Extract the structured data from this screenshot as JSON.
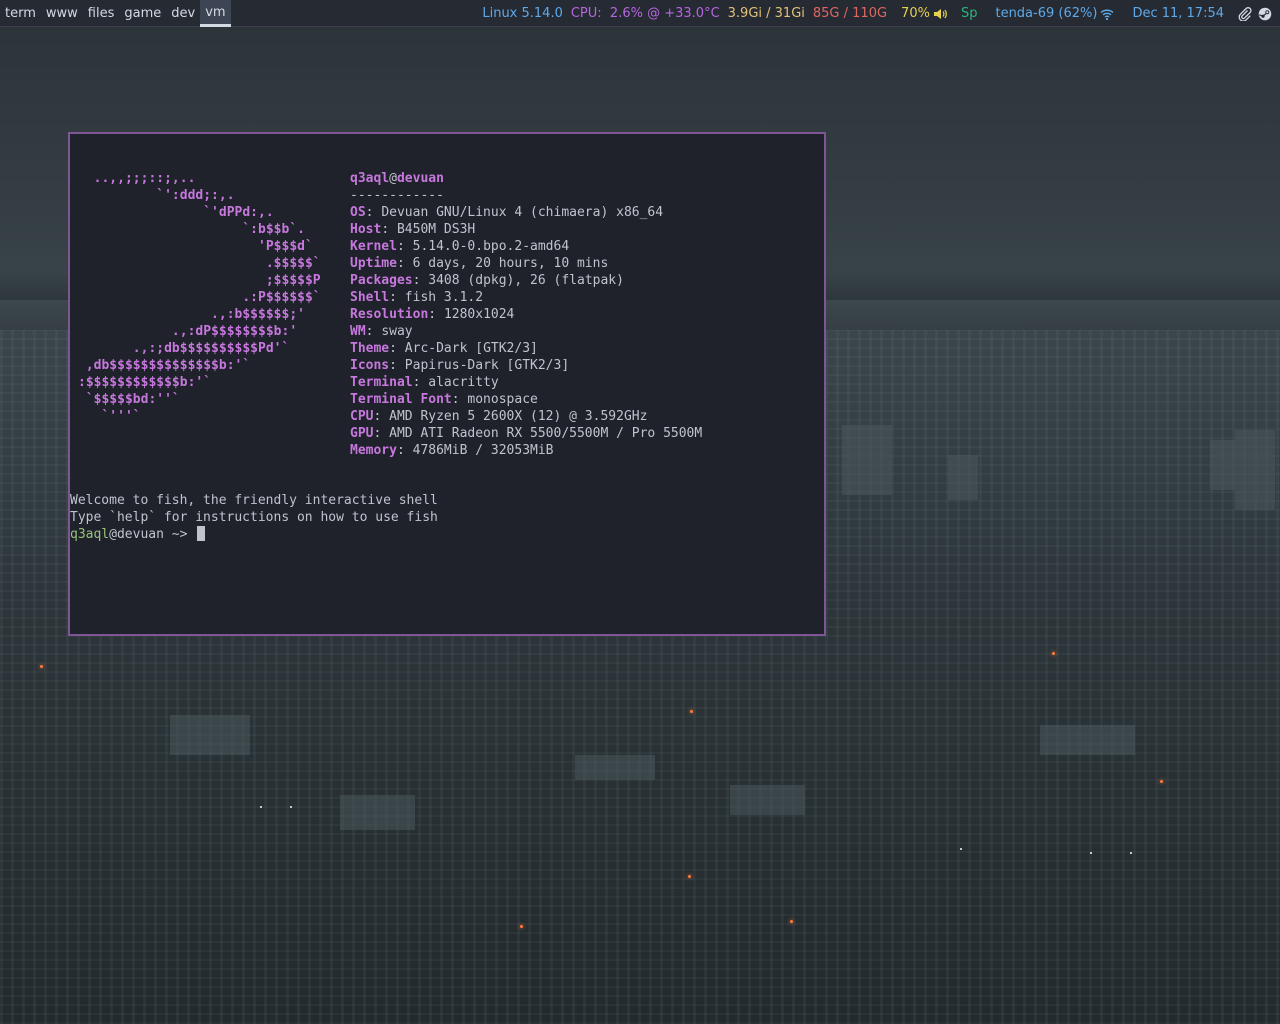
{
  "workspaces": [
    {
      "label": "term",
      "active": false
    },
    {
      "label": "www",
      "active": false
    },
    {
      "label": "files",
      "active": false
    },
    {
      "label": "game",
      "active": false
    },
    {
      "label": "dev",
      "active": false
    },
    {
      "label": "vm",
      "active": true
    }
  ],
  "status": {
    "kernel": {
      "text": "Linux 5.14.0",
      "color": "#5da9e9"
    },
    "cpu": {
      "text": "CPU:  2.6% @ +33.0°C",
      "color": "#b765e0"
    },
    "mem": {
      "text": "3.9Gi / 31Gi",
      "color": "#e2c275"
    },
    "disk": {
      "text": "85G / 110G",
      "color": "#e0675f"
    },
    "volume": {
      "text": "70%",
      "color": "#e6d04f",
      "icon": "volume-icon"
    },
    "sp": {
      "text": "Sp",
      "color": "#2fb37d"
    },
    "wifi": {
      "text": "tenda-69 (62%)",
      "color": "#5da9e9",
      "icon": "wifi-icon"
    },
    "clock": {
      "text": "Dec 11, 17:54",
      "color": "#5da9e9"
    },
    "tray_icons": [
      "paperclip-icon",
      "steam-icon"
    ]
  },
  "terminal": {
    "ascii_art": "  ..,,;;;::;,..\n          `':ddd;:,.\n                `'dPPd:,.\n                     `:b$$b`.\n                       'P$$$d`\n                        .$$$$$`\n                        ;$$$$$P\n                     .:P$$$$$$`\n                 .,:b$$$$$$;'\n            .,:dP$$$$$$$$b:'\n       .,:;db$$$$$$$$$$Pd'`\n ,db$$$$$$$$$$$$$$b:'`\n:$$$$$$$$$$$$b:'`\n `$$$$$bd:''`\n   `'''`",
    "user": "q3aql",
    "at": "@",
    "host": "devuan",
    "separator": "------------",
    "info": [
      {
        "key": "OS",
        "value": "Devuan GNU/Linux 4 (chimaera) x86_64"
      },
      {
        "key": "Host",
        "value": "B450M DS3H"
      },
      {
        "key": "Kernel",
        "value": "5.14.0-0.bpo.2-amd64"
      },
      {
        "key": "Uptime",
        "value": "6 days, 20 hours, 10 mins"
      },
      {
        "key": "Packages",
        "value": "3408 (dpkg), 26 (flatpak)"
      },
      {
        "key": "Shell",
        "value": "fish 3.1.2"
      },
      {
        "key": "Resolution",
        "value": "1280x1024"
      },
      {
        "key": "WM",
        "value": "sway"
      },
      {
        "key": "Theme",
        "value": "Arc-Dark [GTK2/3]"
      },
      {
        "key": "Icons",
        "value": "Papirus-Dark [GTK2/3]"
      },
      {
        "key": "Terminal",
        "value": "alacritty"
      },
      {
        "key": "Terminal Font",
        "value": "monospace"
      },
      {
        "key": "CPU",
        "value": "AMD Ryzen 5 2600X (12) @ 3.592GHz"
      },
      {
        "key": "GPU",
        "value": "AMD ATI Radeon RX 5500/5500M / Pro 5500M"
      },
      {
        "key": "Memory",
        "value": "4786MiB / 32053MiB"
      }
    ],
    "welcome_line1": "Welcome to fish, the friendly interactive shell",
    "welcome_line2": "Type `help` for instructions on how to use fish",
    "prompt_user": "q3aql",
    "prompt_host": "@devuan ~>"
  }
}
